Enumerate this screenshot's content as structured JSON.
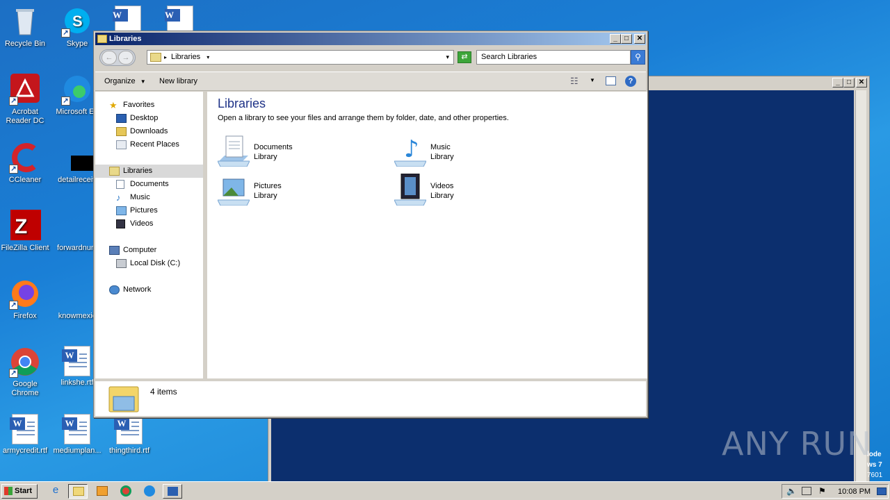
{
  "desktop": {
    "icons": [
      {
        "label": "Recycle Bin",
        "icon": "recycle-bin-icon"
      },
      {
        "label": "Skype",
        "icon": "skype-icon"
      },
      {
        "label": "Acrobat Reader DC",
        "icon": "acrobat-icon"
      },
      {
        "label": "Microsoft Ed",
        "icon": "edge-icon"
      },
      {
        "label": "CCleaner",
        "icon": "ccleaner-icon"
      },
      {
        "label": "detailreceiv",
        "icon": "file-icon"
      },
      {
        "label": "FileZilla Client",
        "icon": "filezilla-icon"
      },
      {
        "label": "forwardnum",
        "icon": "file-icon"
      },
      {
        "label": "Firefox",
        "icon": "firefox-icon"
      },
      {
        "label": "knowmexic",
        "icon": "file-icon"
      },
      {
        "label": "Google Chrome",
        "icon": "chrome-icon"
      },
      {
        "label": "linkshe.rtf",
        "icon": "word-doc-icon"
      },
      {
        "label": "armycredit.rtf",
        "icon": "word-doc-icon"
      },
      {
        "label": "mediumplan...",
        "icon": "word-doc-icon"
      },
      {
        "label": "thingthird.rtf",
        "icon": "word-doc-icon"
      }
    ]
  },
  "explorer": {
    "title": "Libraries",
    "address": {
      "crumb": "Libraries"
    },
    "search": {
      "placeholder": "Search Libraries"
    },
    "toolbar": {
      "organize": "Organize",
      "new_library": "New library"
    },
    "nav": {
      "favorites": "Favorites",
      "desktop": "Desktop",
      "downloads": "Downloads",
      "recent": "Recent Places",
      "libraries": "Libraries",
      "documents": "Documents",
      "music": "Music",
      "pictures": "Pictures",
      "videos": "Videos",
      "computer": "Computer",
      "local_disk": "Local Disk (C:)",
      "network": "Network"
    },
    "content": {
      "heading": "Libraries",
      "description": "Open a library to see your files and arrange them by folder, date, and other properties.",
      "libraries": [
        {
          "name": "Documents",
          "type": "Library"
        },
        {
          "name": "Music",
          "type": "Library"
        },
        {
          "name": "Pictures",
          "type": "Library"
        },
        {
          "name": "Videos",
          "type": "Library"
        }
      ]
    },
    "details": {
      "count": "4 items"
    }
  },
  "taskbar": {
    "start": "Start",
    "clock": "10:08 PM"
  },
  "background_window": {
    "edge_text": [
      "lode",
      "ws 7",
      "7601"
    ]
  },
  "watermark": "ANY RUN",
  "colors": {
    "desktop": "#1a7fd6",
    "titlebar": "#0a246a",
    "console": "#0c2f6e"
  }
}
